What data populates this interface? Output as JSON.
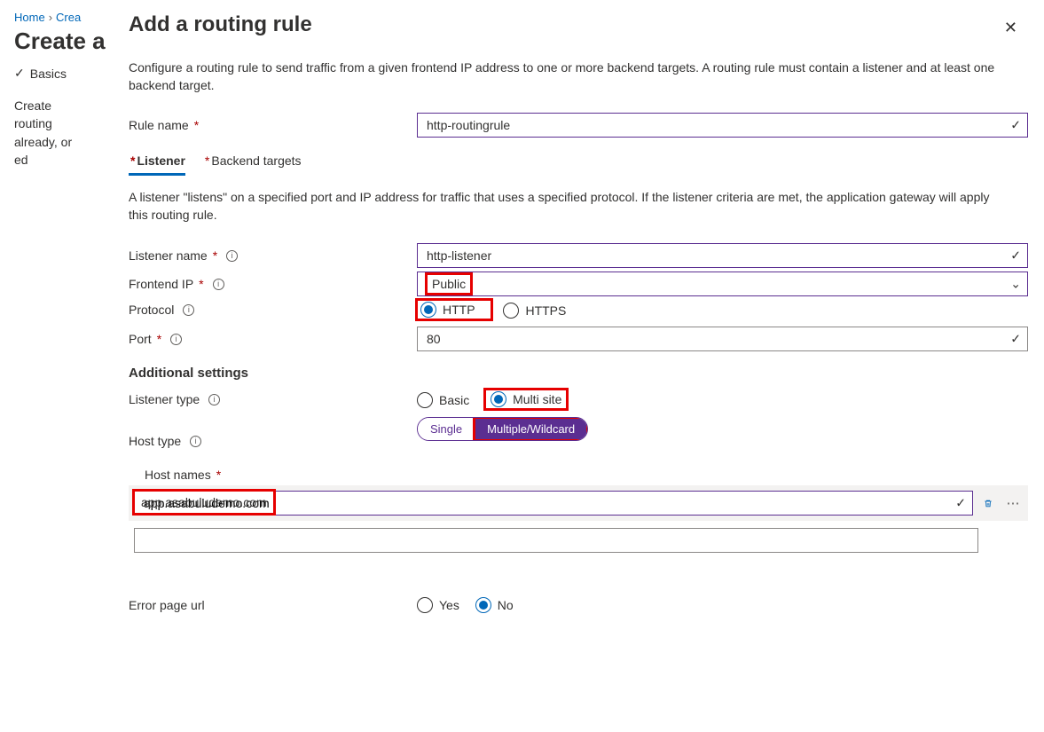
{
  "breadcrumb": {
    "home": "Home",
    "next": "Crea"
  },
  "pageHeading": "Create a",
  "wizard": {
    "step1": "Basics"
  },
  "leftDesc": "Create routing already, or ed",
  "panel": {
    "title": "Add a routing rule",
    "desc": "Configure a routing rule to send traffic from a given frontend IP address to one or more backend targets. A routing rule must contain a listener and at least one backend target.",
    "ruleNameLabel": "Rule name",
    "ruleNameValue": "http-routingrule",
    "tabs": {
      "listener": "Listener",
      "backend": "Backend targets"
    },
    "listenerDesc": "A listener \"listens\" on a specified port and IP address for traffic that uses a specified protocol. If the listener criteria are met, the application gateway will apply this routing rule.",
    "listenerNameLabel": "Listener name",
    "listenerNameValue": "http-listener",
    "frontendIpLabel": "Frontend IP",
    "frontendIpValue": "Public",
    "protocolLabel": "Protocol",
    "protocol": {
      "http": "HTTP",
      "https": "HTTPS"
    },
    "portLabel": "Port",
    "portValue": "80",
    "addSettings": "Additional settings",
    "listenerTypeLabel": "Listener type",
    "listenerType": {
      "basic": "Basic",
      "multi": "Multi site"
    },
    "hostTypeLabel": "Host type",
    "hostType": {
      "single": "Single",
      "multi": "Multiple/Wildcard"
    },
    "hostNamesLabel": "Host names",
    "hostNameValue": "app.asabuludemo.com",
    "errorPageLabel": "Error page url",
    "errorPage": {
      "yes": "Yes",
      "no": "No"
    }
  }
}
